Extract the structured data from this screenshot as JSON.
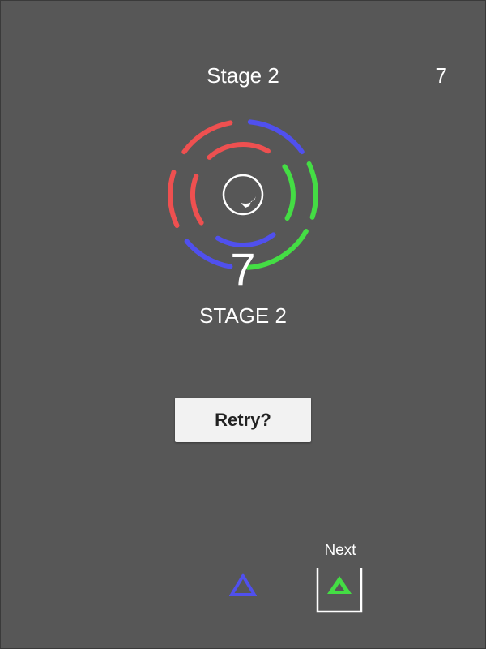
{
  "hud": {
    "stage_title": "Stage 2",
    "score": "7"
  },
  "game": {
    "score_display": "7",
    "stage_label": "STAGE 2",
    "retry_label": "Retry?",
    "next_label": "Next",
    "current_piece": {
      "shape": "triangle",
      "color": "#5050ee"
    },
    "next_piece": {
      "shape": "triangle",
      "color": "#44dd44"
    }
  },
  "colors": {
    "background": "#575757",
    "red": "#ee5050",
    "blue": "#5050ee",
    "green": "#44dd44",
    "white": "#ffffff"
  }
}
